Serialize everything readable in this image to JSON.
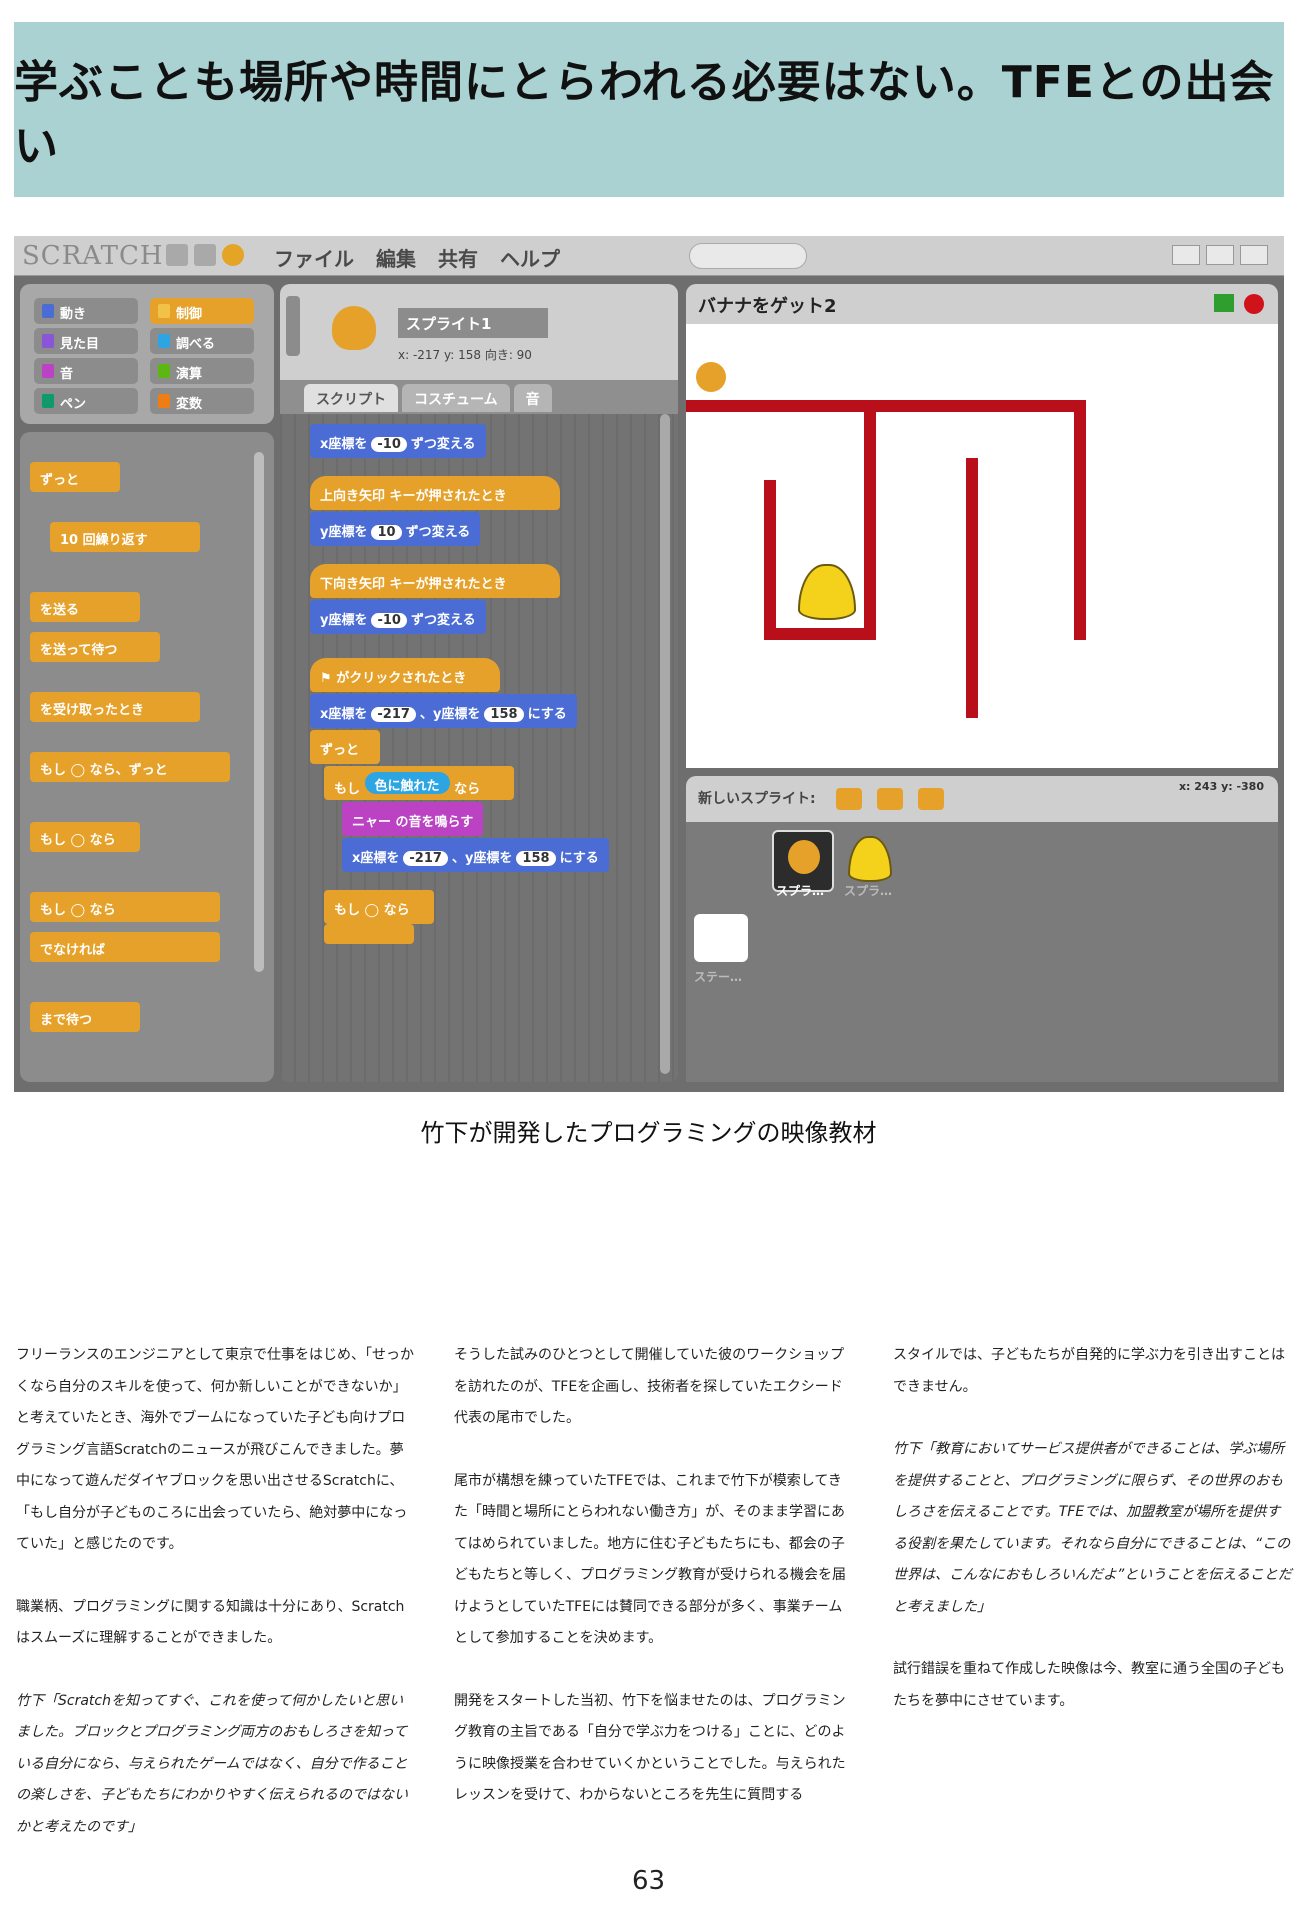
{
  "header": {
    "title": "学ぶことも場所や時間にとらわれる必要はない。TFEとの出会い"
  },
  "screenshot": {
    "logo": "SCRATCH",
    "menu": [
      "ファイル",
      "編集",
      "共有",
      "ヘルプ"
    ],
    "categories": [
      "動き",
      "制御",
      "見た目",
      "調べる",
      "音",
      "演算",
      "ペン",
      "変数"
    ],
    "palette_blocks": [
      "ずっと",
      "10 回繰り返す",
      "を送る",
      "を送って待つ",
      "を受け取ったとき",
      "もし ◯ なら、ずっと",
      "もし ◯ なら",
      "もし ◯ なら",
      "でなければ",
      "まで待つ"
    ],
    "sprite_name": "スプライト1",
    "sprite_coords": "x: -217  y: 158  向き: 90",
    "tabs": [
      "スクリプト",
      "コスチューム",
      "音"
    ],
    "code_blocks": [
      {
        "label": "x座標を",
        "num": "-10",
        "tail": "ずつ変える"
      },
      {
        "label": "上向き矢印",
        "tail": "キーが押されたとき"
      },
      {
        "label": "y座標を",
        "num": "10",
        "tail": "ずつ変える"
      },
      {
        "label": "下向き矢印",
        "tail": "キーが押されたとき"
      },
      {
        "label": "y座標を",
        "num": "-10",
        "tail": "ずつ変える"
      },
      {
        "label": "",
        "tail": "がクリックされたとき"
      },
      {
        "label": "x座標を",
        "num": "-217",
        "tail": "、y座標を",
        "num2": "158",
        "tail2": "にする"
      },
      {
        "label": "ずっと"
      },
      {
        "label": "もし",
        "tail": "色に触れた",
        "tail2": "なら"
      },
      {
        "label": "ニャー",
        "tail": "の音を鳴らす"
      },
      {
        "label": "x座標を",
        "num": "-217",
        "tail": "、y座標を",
        "num2": "158",
        "tail2": "にする"
      },
      {
        "label": "もし",
        "tail2": "なら"
      }
    ],
    "stage_title": "バナナをゲット2",
    "new_sprite": "新しいスプライト:",
    "mouse_xy": "x: 243   y: -380",
    "sprites": [
      "スプラ…",
      "スプラ…"
    ],
    "stage_label": "ステー…"
  },
  "caption": "竹下が開発したプログラミングの映像教材",
  "columns": [
    [
      {
        "italic": false,
        "text": "フリーランスのエンジニアとして東京で仕事をはじめ、「せっかくなら自分のスキルを使って、何か新しいことができないか」と考えていたとき、海外でブームになっていた子ども向けプログラミング言語Scratchのニュースが飛びこんできました。夢中になって遊んだダイヤブロックを思い出させるScratchに、「もし自分が子どものころに出会っていたら、絶対夢中になっていた」と感じたのです。"
      },
      {
        "italic": false,
        "text": "職業柄、プログラミングに関する知識は十分にあり、Scratchはスムーズに理解することができました。"
      },
      {
        "italic": true,
        "text": "竹下「Scratchを知ってすぐ、これを使って何かしたいと思いました。ブロックとプログラミング両方のおもしろさを知っている自分になら、与えられたゲームではなく、自分で作ることの楽しさを、子どもたちにわかりやすく伝えられるのではないかと考えたのです」"
      }
    ],
    [
      {
        "italic": false,
        "text": "そうした試みのひとつとして開催していた彼のワークショップを訪れたのが、TFEを企画し、技術者を探していたエクシード代表の尾市でした。"
      },
      {
        "italic": false,
        "text": "尾市が構想を練っていたTFEでは、これまで竹下が模索してきた「時間と場所にとらわれない働き方」が、そのまま学習にあてはめられていました。地方に住む子どもたちにも、都会の子どもたちと等しく、プログラミング教育が受けられる機会を届けようとしていたTFEには賛同できる部分が多く、事業チームとして参加することを決めます。"
      },
      {
        "italic": false,
        "text": "開発をスタートした当初、竹下を悩ませたのは、プログラミング教育の主旨である「自分で学ぶ力をつける」ことに、どのように映像授業を合わせていくかということでした。与えられたレッスンを受けて、わからないところを先生に質問する"
      }
    ],
    [
      {
        "italic": false,
        "text": "スタイルでは、子どもたちが自発的に学ぶ力を引き出すことはできません。"
      },
      {
        "italic": true,
        "text": "竹下「教育においてサービス提供者ができることは、学ぶ場所を提供することと、プログラミングに限らず、その世界のおもしろさを伝えることです。TFEでは、加盟教室が場所を提供する役割を果たしています。それなら自分にできることは、“この世界は、こんなにおもしろいんだよ”ということを伝えることだと考えました」"
      },
      {
        "italic": false,
        "text": "試行錯誤を重ねて作成した映像は今、教室に通う全国の子どもたちを夢中にさせています。"
      }
    ]
  ],
  "page_number": "63"
}
